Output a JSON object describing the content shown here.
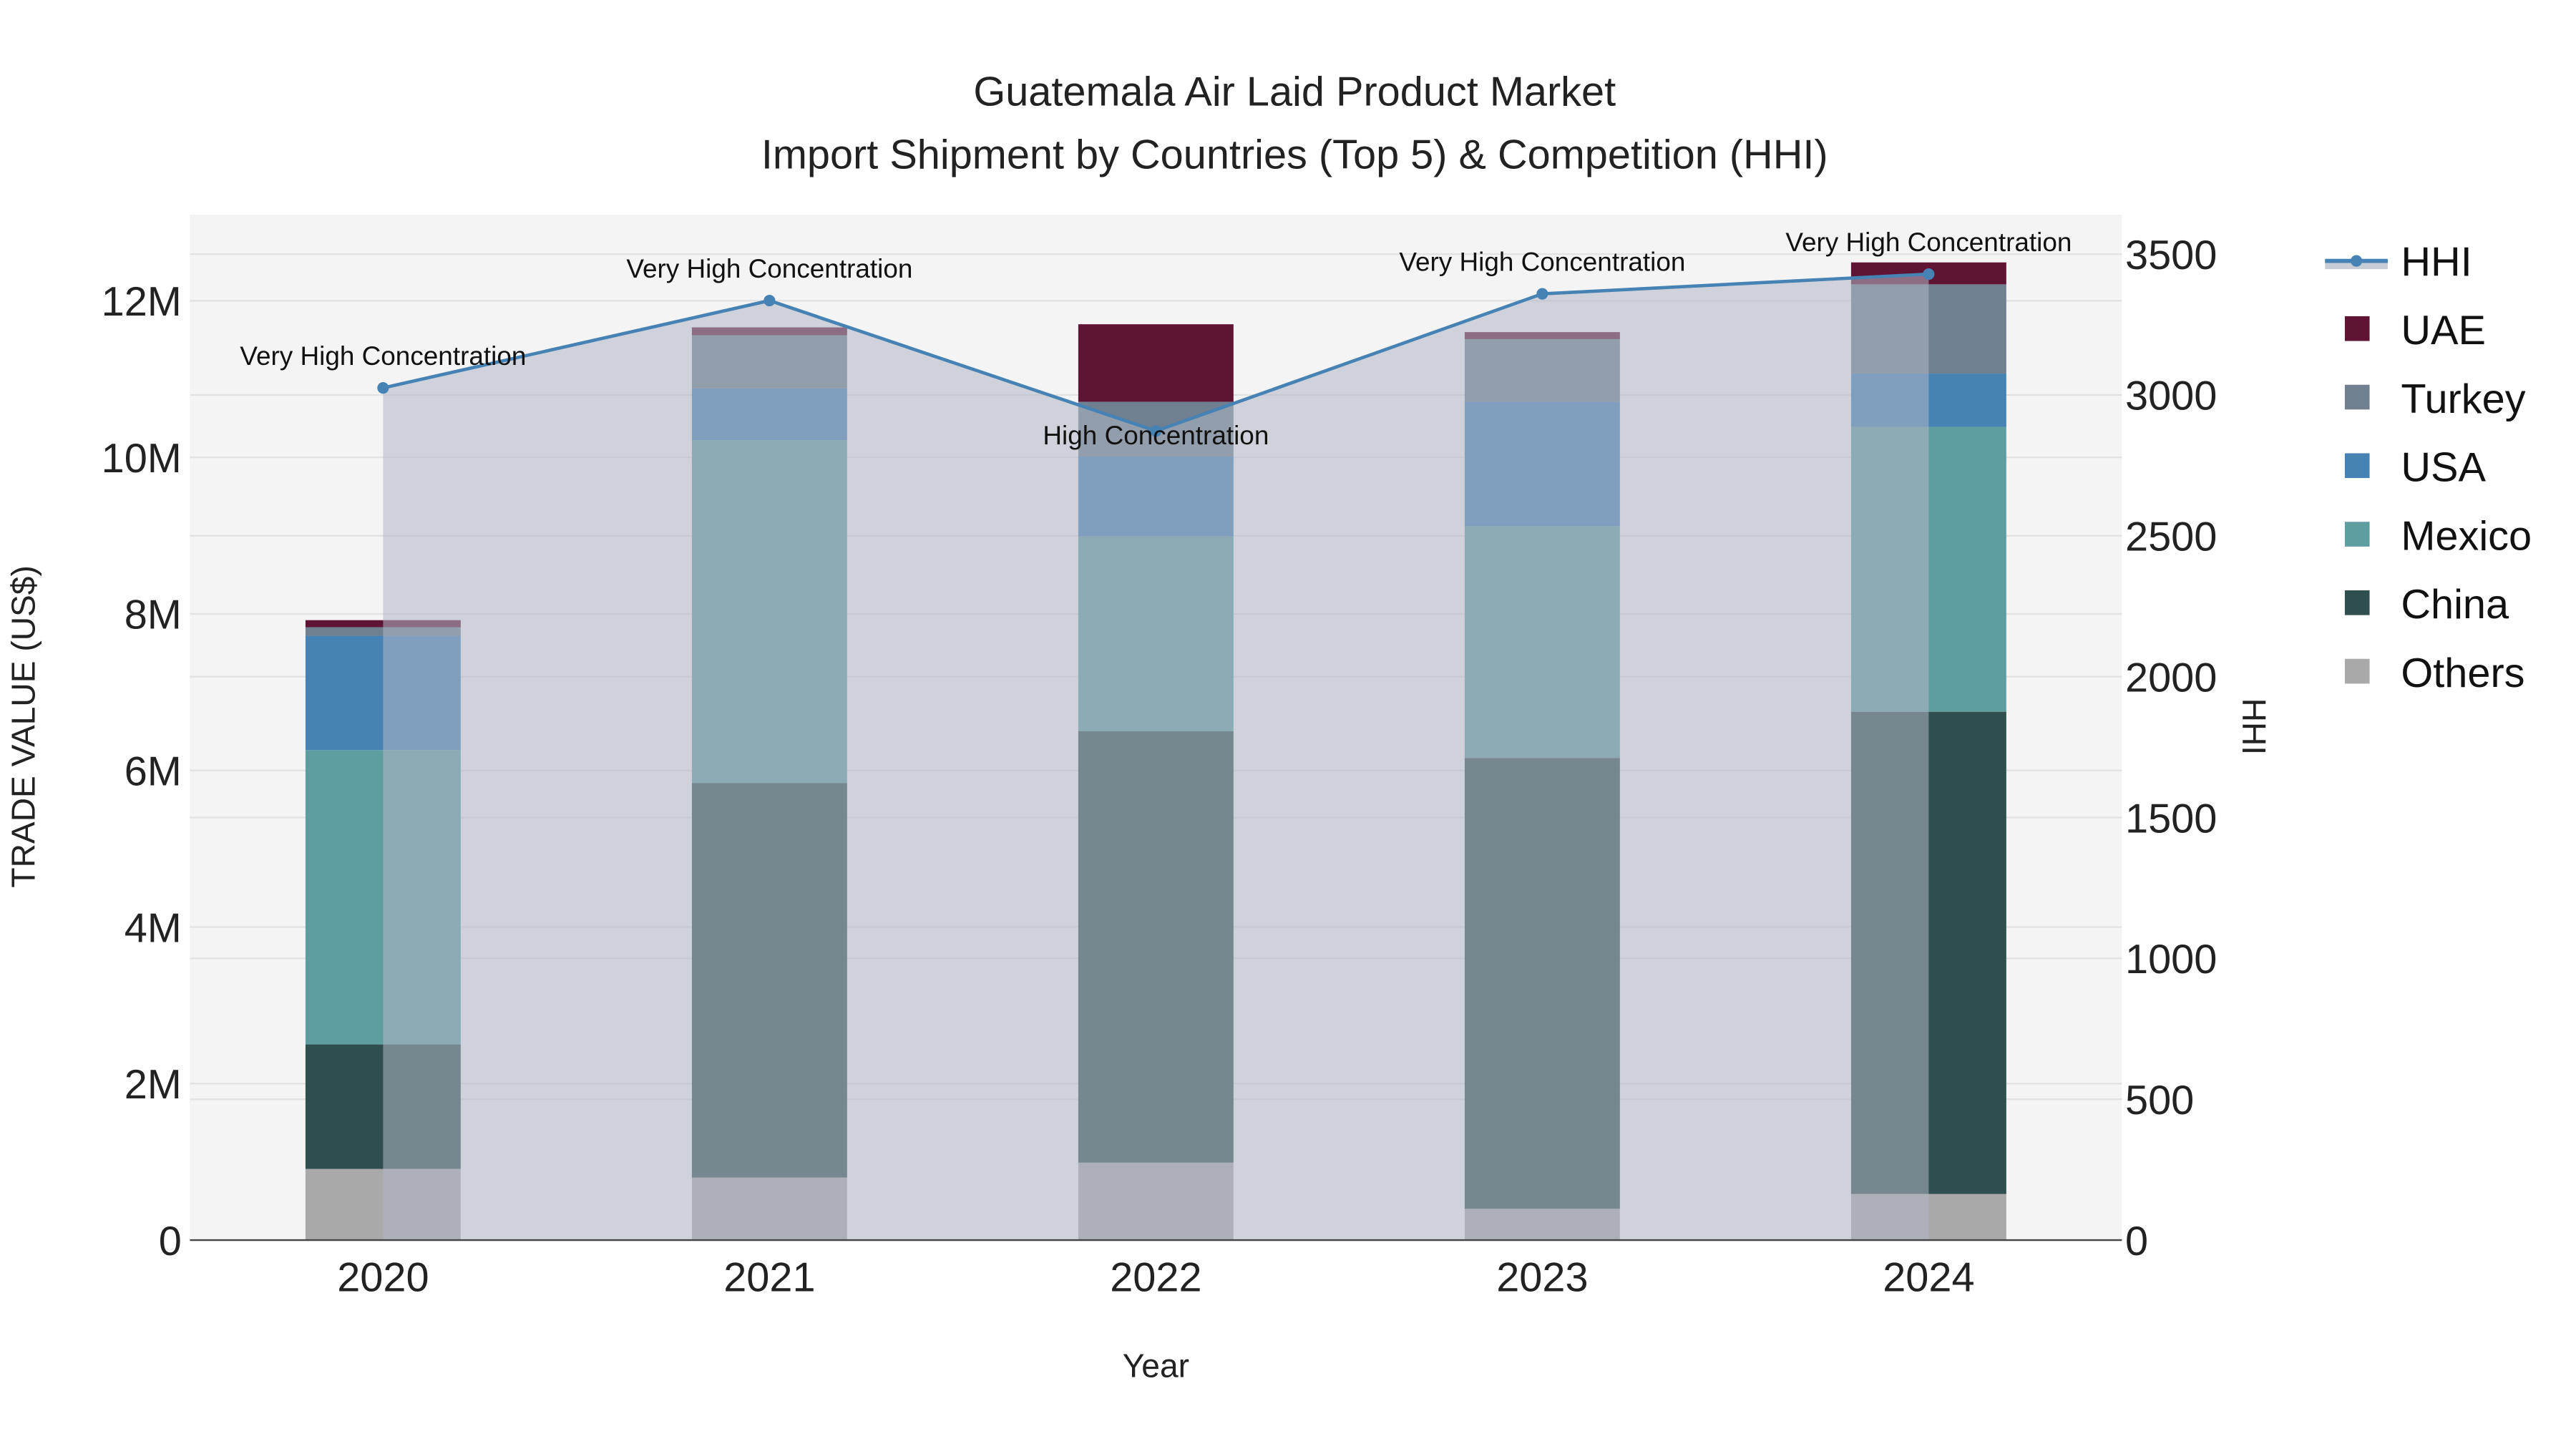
{
  "chart_data": {
    "type": "bar",
    "stacked": true,
    "title": "Guatemala Air Laid Product Market",
    "subtitle": "Import Shipment by Countries (Top 5) & Competition (HHI)",
    "xlabel": "Year",
    "ylabel": "TRADE VALUE (US$)",
    "y2label": "HHI",
    "categories": [
      "2020",
      "2021",
      "2022",
      "2023",
      "2024"
    ],
    "ylim": [
      0,
      13100000
    ],
    "y_ticks": [
      0,
      2000000,
      4000000,
      6000000,
      8000000,
      10000000,
      12000000
    ],
    "y_tick_labels": [
      "0",
      "2M",
      "4M",
      "6M",
      "8M",
      "10M",
      "12M"
    ],
    "y2lim": [
      0,
      3640
    ],
    "y2_ticks": [
      0,
      500,
      1000,
      1500,
      2000,
      2500,
      3000,
      3500
    ],
    "y2_tick_labels": [
      "0",
      "500",
      "1000",
      "1500",
      "2000",
      "2500",
      "3000",
      "3500"
    ],
    "grid": true,
    "legend_position": "right",
    "series": [
      {
        "name": "Others",
        "color": "#a9a9a9",
        "values": [
          910000,
          800000,
          990000,
          400000,
          590000
        ]
      },
      {
        "name": "China",
        "color": "#2f4f4f",
        "values": [
          1590000,
          5040000,
          5510000,
          5760000,
          6160000
        ]
      },
      {
        "name": "Mexico",
        "color": "#5f9ea0",
        "values": [
          3760000,
          4380000,
          2490000,
          2960000,
          3640000
        ]
      },
      {
        "name": "USA",
        "color": "#4682b4",
        "values": [
          1460000,
          660000,
          1020000,
          1590000,
          680000
        ]
      },
      {
        "name": "Turkey",
        "color": "#708090",
        "values": [
          110000,
          680000,
          700000,
          800000,
          1140000
        ]
      },
      {
        "name": "UAE",
        "color": "#601434",
        "values": [
          90000,
          100000,
          990000,
          90000,
          280000
        ]
      }
    ],
    "hhi": {
      "name": "HHI",
      "color": "#4682b4",
      "values": [
        3025,
        3335,
        2872,
        3359,
        3429
      ],
      "annotations": [
        "Very High Concentration",
        "Very High Concentration",
        "High Concentration",
        "Very High Concentration",
        "Very High Concentration"
      ]
    },
    "legend_order": [
      "HHI",
      "UAE",
      "Turkey",
      "USA",
      "Mexico",
      "China",
      "Others"
    ]
  }
}
